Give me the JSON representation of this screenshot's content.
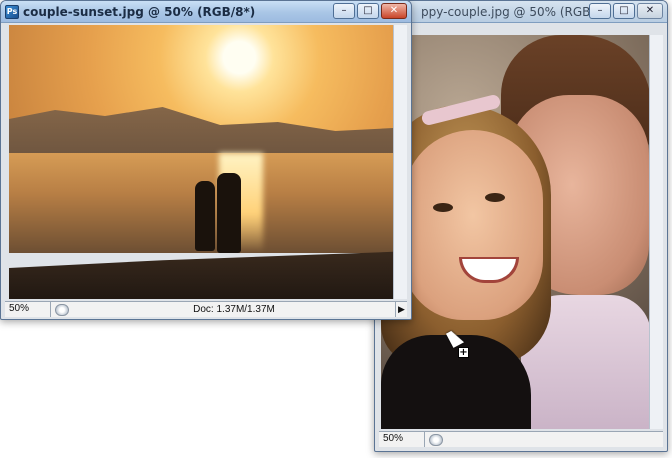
{
  "windows": {
    "front": {
      "title": "couple-sunset.jpg @ 50% (RGB/8*)",
      "app_icon_label": "Ps",
      "controls": {
        "minimize": "–",
        "maximize": "□",
        "close": "✕"
      },
      "status": {
        "zoom": "50%",
        "doc": "Doc: 1.37M/1.37M",
        "arrow": "▶"
      }
    },
    "back": {
      "title": "ppy-couple.jpg @ 50% (RGB/...",
      "controls": {
        "minimize": "–",
        "maximize": "□",
        "close": "✕"
      },
      "status": {
        "zoom": "50%"
      }
    }
  },
  "cursor": {
    "icon": "move-copy-cursor",
    "badge": "+"
  }
}
